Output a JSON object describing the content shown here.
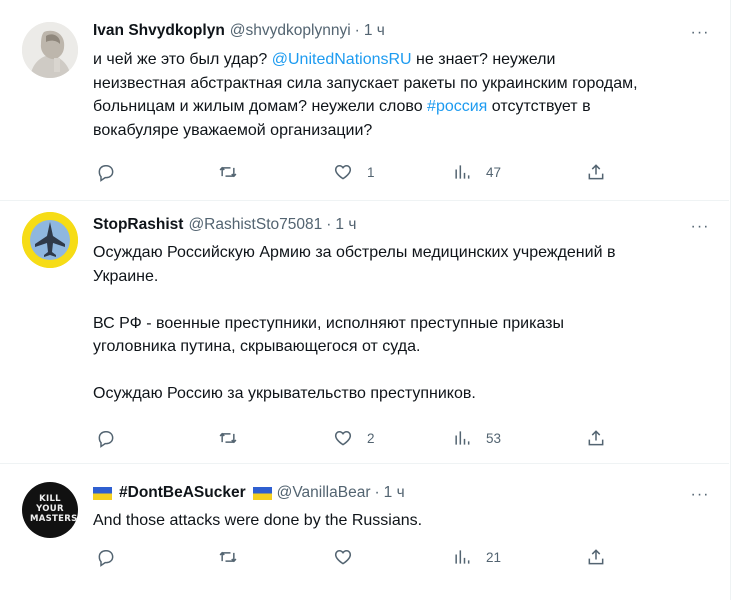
{
  "tweets": [
    {
      "name": "Ivan Shvydkoplyn",
      "handle": "@shvydkoplynnyi",
      "sep": "·",
      "time": "1 ч",
      "more": "···",
      "line1_a": "и чей же это был удар? ",
      "line1_link": "@UnitedNationsRU",
      "line1_b": " не знает? неужели",
      "line2": "неизвестная абстрактная сила запускает ракеты по украинским городам,",
      "line3_a": "больницам и жилым домам? неужели слово ",
      "line3_link": "#россия",
      "line3_b": " отсутствует в",
      "line4": "вокабуляре уважаемой организации?",
      "replies": "",
      "retweets": "",
      "likes": "1",
      "views": "47"
    },
    {
      "name": "StopRashist",
      "handle": "@RashistSto75081",
      "sep": "·",
      "time": "1 ч",
      "more": "···",
      "line1": "Осуждаю Российскую Армию за обстрелы медицинских учреждений в",
      "line2": "Украине.",
      "line3": "ВС РФ - военные преступники, исполняют преступные приказы",
      "line4": "уголовника путина, скрывающегося от суда.",
      "line5": "Осуждаю Россию за укрывательство преступников.",
      "replies": "",
      "retweets": "",
      "likes": "2",
      "views": "53"
    },
    {
      "name": "#DontBeASucker",
      "handle": "@VanillaBear",
      "sep": "·",
      "time": "1 ч",
      "more": "···",
      "avatar_text": "KILL YOUR MASTERS",
      "line1": "And those attacks were done by the Russians.",
      "replies": "",
      "retweets": "",
      "likes": "",
      "views": "21"
    }
  ],
  "colors": {
    "link": "#1d9bf0",
    "secondary": "#536471",
    "text": "#0f1419",
    "divider": "#eff3f4",
    "flag_blue": "#2f5fd0",
    "flag_yellow": "#f5d020"
  },
  "icons": [
    "reply-icon",
    "retweet-icon",
    "like-icon",
    "views-icon",
    "share-icon",
    "more-icon"
  ]
}
